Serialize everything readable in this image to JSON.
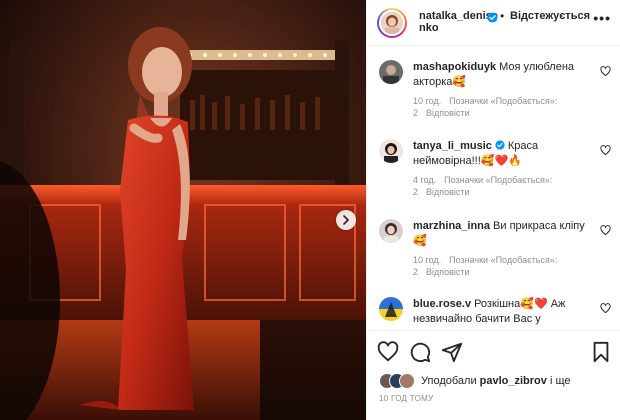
{
  "post": {
    "owner": "natalka_denisenko",
    "follow_status": "Відстежується",
    "dot": "•",
    "more": "•••"
  },
  "comments": [
    {
      "username": "mashapokiduyk",
      "text": "Моя улюблена акторка🥰",
      "time": "10 год.",
      "likes": "Позначки «Подобається»: 2",
      "reply": "Відповісти"
    },
    {
      "username": "tanya_li_music",
      "text": "Краса неймовірна!!!🥰❤️🔥",
      "time": "4 год.",
      "likes": "Позначки «Подобається»: 2",
      "reply": "Відповісти"
    },
    {
      "username": "marzhina_inna",
      "text": "Ви прикраса кліпу 🥰",
      "time": "10 год.",
      "likes": "Позначки «Подобається»: 2",
      "reply": "Відповісти"
    },
    {
      "username": "blue.rose.v",
      "text": "Розкішна🥰❤️ Аж незвичайно бачити Вас у",
      "time": "",
      "likes": "",
      "reply": ""
    }
  ],
  "likes_line": {
    "prefix": "Уподобали",
    "user": "pavlo_zibrov",
    "suffix": "і ще"
  },
  "timestamp": "10 ГОД ТОМУ",
  "icons": {
    "heart": "heart-icon",
    "comment": "comment-icon",
    "share": "share-icon",
    "save": "bookmark-icon",
    "verified": "verified-badge-icon",
    "next": "chevron-right-icon"
  },
  "colors": {
    "accent": "#0095f6",
    "text": "#262626",
    "muted": "#8e8e8e",
    "border": "#efefef"
  }
}
